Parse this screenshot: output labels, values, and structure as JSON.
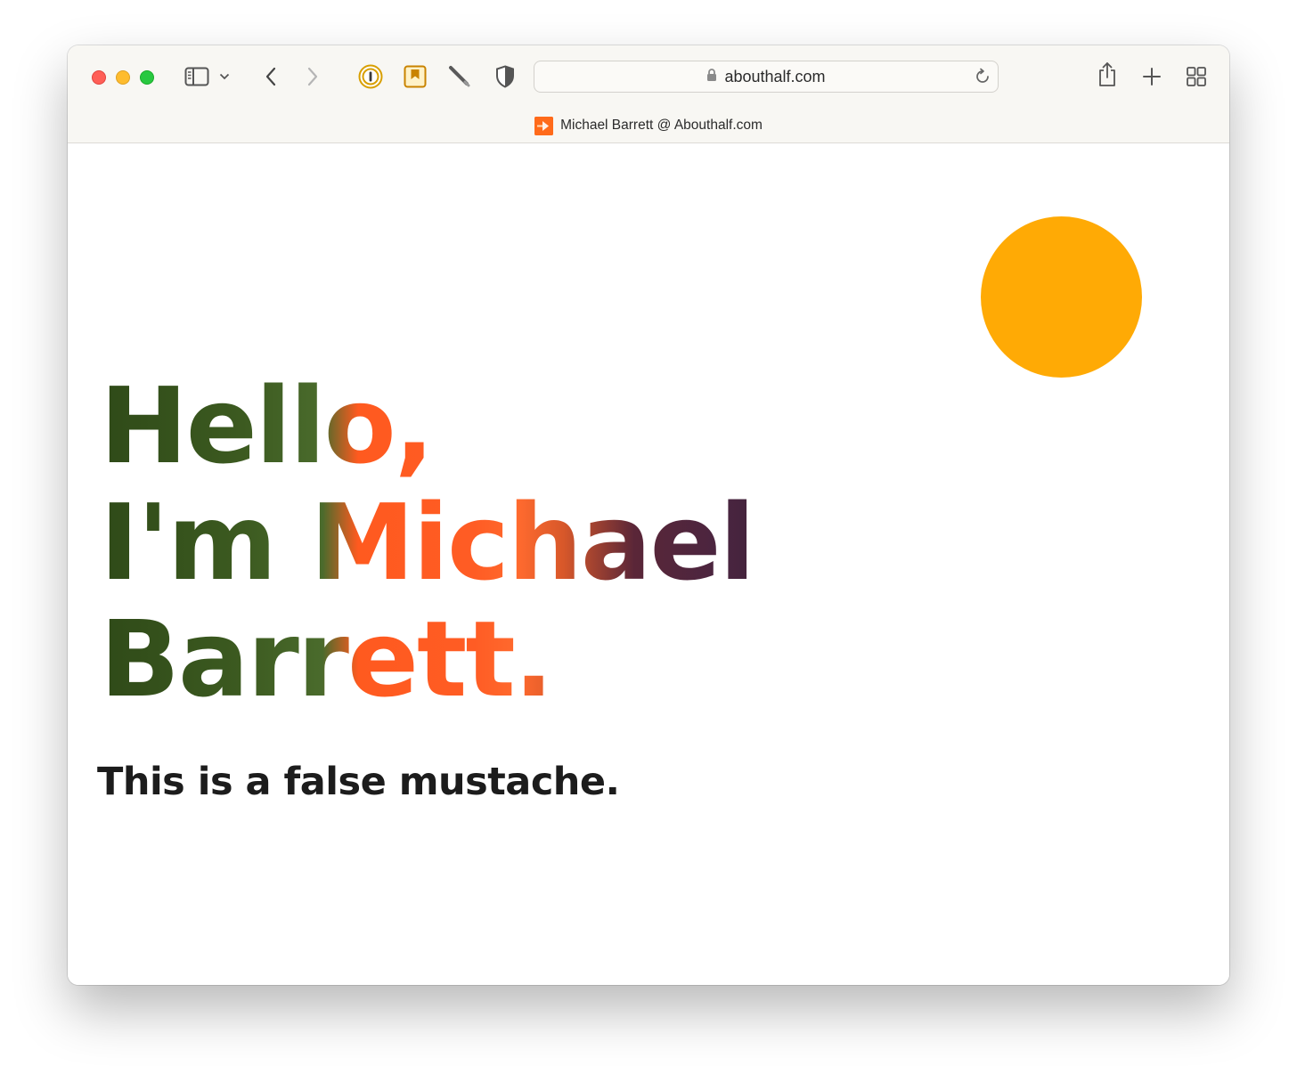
{
  "browser": {
    "url": "abouthalf.com",
    "tab_title": "Michael Barrett @ Abouthalf.com",
    "icons": [
      "sidebar-icon",
      "chevron-down-icon",
      "back-arrow-icon",
      "forward-arrow-icon",
      "password-manager-icon",
      "bookmark-icon",
      "pen-icon",
      "shield-icon",
      "lock-icon",
      "reload-icon",
      "share-icon",
      "plus-icon",
      "tab-overview-icon"
    ]
  },
  "page": {
    "hero_lines": [
      "Hello,",
      "I'm Michael",
      "Barrett."
    ],
    "tagline": "This is a false mustache.",
    "sun_color": "#ffaa05"
  }
}
